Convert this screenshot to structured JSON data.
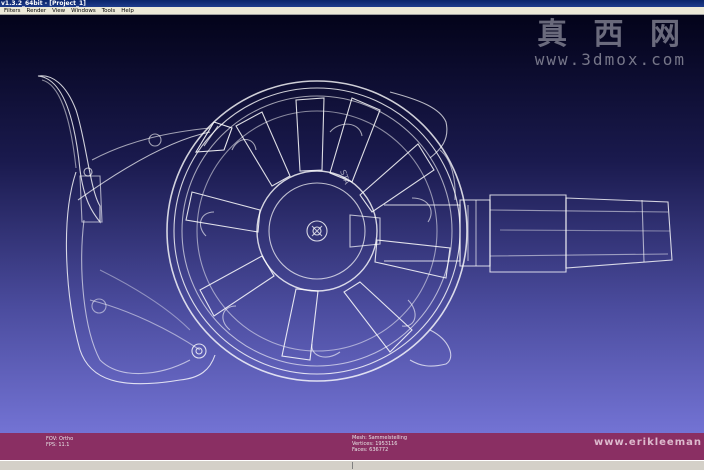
{
  "window": {
    "title": "v1.3.2_64bit - [Project_1]"
  },
  "menu": {
    "items": [
      "Filters",
      "Render",
      "View",
      "Windows",
      "Tools",
      "Help"
    ]
  },
  "watermark": {
    "text": "真 西 网",
    "url": "www.3dmox.com"
  },
  "status": {
    "fov": "FOV: Ortho",
    "fps": "FPS:    11.1",
    "mesh": "Mesh: Sammelstelling",
    "vertices": "Vertices: 1953116",
    "faces": "Faces: 636772",
    "credit": "www.erikleeman"
  },
  "colors": {
    "viewport_top": "#03031a",
    "viewport_bottom": "#7373d4",
    "statusbar": "#8a2f63",
    "wireframe": "#ffffff"
  }
}
